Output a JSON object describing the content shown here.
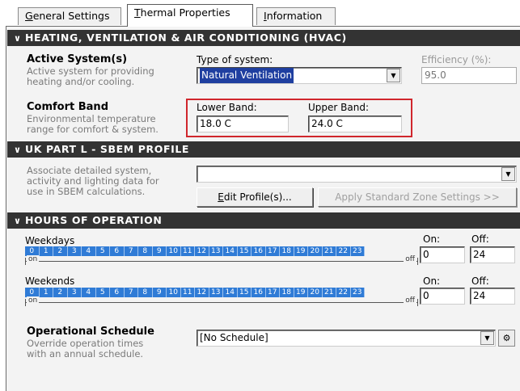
{
  "tabs": [
    {
      "label": "General Settings",
      "underline": "G",
      "rest": "eneral Settings"
    },
    {
      "label": "Thermal Properties",
      "underline": "T",
      "rest": "hermal Properties"
    },
    {
      "label": "Information",
      "underline": "I",
      "rest": "nformation"
    }
  ],
  "hvac": {
    "header": "HEATING, VENTILATION & AIR CONDITIONING (HVAC)",
    "active_title": "Active System(s)",
    "active_desc_1": "Active system for providing",
    "active_desc_2": "heating and/or cooling.",
    "type_label": "Type of system:",
    "type_value": "Natural Ventilation",
    "efficiency_label": "Efficiency (%):",
    "efficiency_value": "95.0",
    "comfort_title": "Comfort Band",
    "comfort_desc_1": "Environmental temperature",
    "comfort_desc_2": "range for comfort & system.",
    "lower_label": "Lower Band:",
    "lower_value": "18.0 C",
    "upper_label": "Upper Band:",
    "upper_value": "24.0 C"
  },
  "sbem": {
    "header": "UK PART L - SBEM PROFILE",
    "desc_1": "Associate detailed system,",
    "desc_2": "activity and lighting data for",
    "desc_3": "use in SBEM calculations.",
    "profile_value": "",
    "edit_underline": "E",
    "edit_rest": "dit Profile(s)...",
    "apply_label": "Apply Standard Zone Settings >>"
  },
  "hours": {
    "header": "HOURS OF OPERATION",
    "weekdays_label": "Weekdays",
    "weekends_label": "Weekends",
    "on_label": "On:",
    "off_label": "Off:",
    "bar_on": "on",
    "bar_off": "off",
    "weekdays_on": "0",
    "weekdays_off": "24",
    "weekends_on": "0",
    "weekends_off": "24",
    "hour_cells": [
      "0",
      "1",
      "2",
      "3",
      "4",
      "5",
      "6",
      "7",
      "8",
      "9",
      "10",
      "11",
      "12",
      "13",
      "14",
      "15",
      "16",
      "17",
      "18",
      "19",
      "20",
      "21",
      "22",
      "23"
    ]
  },
  "schedule": {
    "title": "Operational Schedule",
    "desc_1": "Override operation times",
    "desc_2": "with an annual schedule.",
    "value": "[No Schedule]"
  },
  "colors": {
    "header_bg": "#333333",
    "hour_cell": "#2f7bd6",
    "highlight_box": "#d0262c",
    "selection": "#1f3fa0"
  }
}
